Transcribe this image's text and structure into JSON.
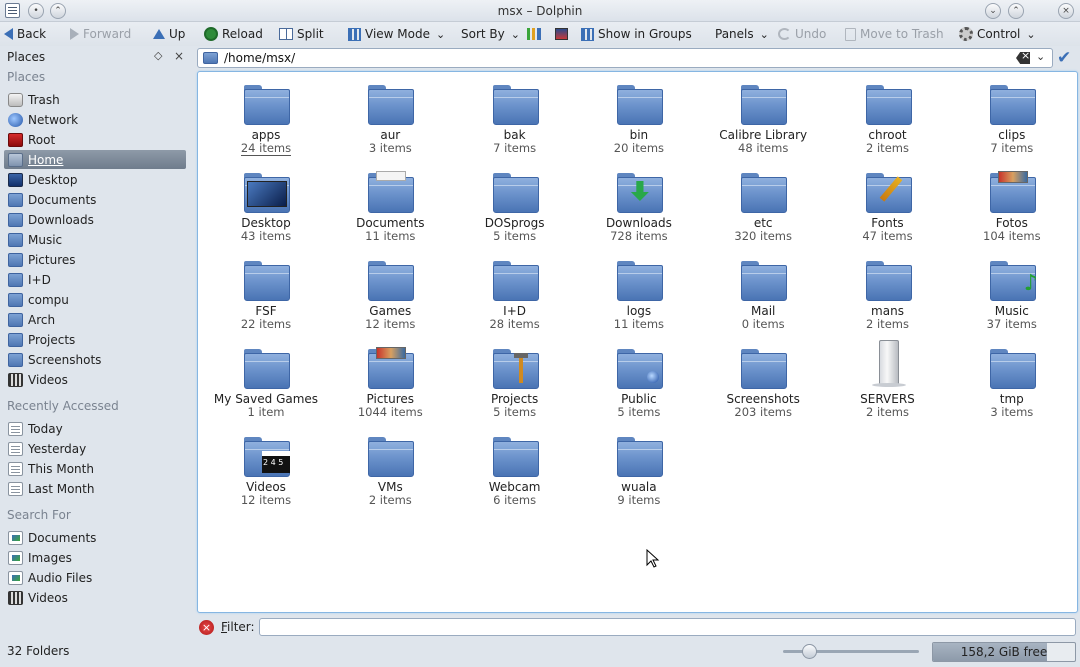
{
  "window": {
    "title": "msx – Dolphin"
  },
  "toolbar": {
    "back": "Back",
    "forward": "Forward",
    "up": "Up",
    "reload": "Reload",
    "split": "Split",
    "view_mode": "View Mode",
    "sort_by": "Sort By",
    "show_in_groups": "Show in Groups",
    "panels": "Panels",
    "undo": "Undo",
    "move_to_trash": "Move to Trash",
    "control": "Control"
  },
  "sidebar": {
    "panel_title": "Places",
    "places_title": "Places",
    "places": [
      {
        "label": "Trash",
        "icon": "trash-icon"
      },
      {
        "label": "Network",
        "icon": "network-icon"
      },
      {
        "label": "Root",
        "icon": "root-icon"
      },
      {
        "label": "Home",
        "icon": "home-icon"
      },
      {
        "label": "Desktop",
        "icon": "desktop-icon"
      },
      {
        "label": "Documents",
        "icon": "folder-icon"
      },
      {
        "label": "Downloads",
        "icon": "folder-icon"
      },
      {
        "label": "Music",
        "icon": "folder-icon"
      },
      {
        "label": "Pictures",
        "icon": "folder-icon"
      },
      {
        "label": "I+D",
        "icon": "folder-icon"
      },
      {
        "label": "compu",
        "icon": "folder-icon"
      },
      {
        "label": "Arch",
        "icon": "folder-icon"
      },
      {
        "label": "Projects",
        "icon": "folder-icon"
      },
      {
        "label": "Screenshots",
        "icon": "folder-icon"
      },
      {
        "label": "Videos",
        "icon": "video-icon"
      }
    ],
    "recent_title": "Recently Accessed",
    "recent": [
      {
        "label": "Today"
      },
      {
        "label": "Yesterday"
      },
      {
        "label": "This Month"
      },
      {
        "label": "Last Month"
      }
    ],
    "search_title": "Search For",
    "search": [
      {
        "label": "Documents"
      },
      {
        "label": "Images"
      },
      {
        "label": "Audio Files"
      },
      {
        "label": "Videos"
      }
    ]
  },
  "location": {
    "path": "/home/msx/"
  },
  "folders": [
    {
      "name": "apps",
      "count": "24 items"
    },
    {
      "name": "aur",
      "count": "3 items"
    },
    {
      "name": "bak",
      "count": "7 items"
    },
    {
      "name": "bin",
      "count": "20 items"
    },
    {
      "name": "Calibre Library",
      "count": "48 items"
    },
    {
      "name": "chroot",
      "count": "2 items"
    },
    {
      "name": "clips",
      "count": "7 items"
    },
    {
      "name": "Desktop",
      "count": "43 items"
    },
    {
      "name": "Documents",
      "count": "11 items"
    },
    {
      "name": "DOSprogs",
      "count": "5 items"
    },
    {
      "name": "Downloads",
      "count": "728 items"
    },
    {
      "name": "etc",
      "count": "320 items"
    },
    {
      "name": "Fonts",
      "count": "47 items"
    },
    {
      "name": "Fotos",
      "count": "104 items"
    },
    {
      "name": "FSF",
      "count": "22 items"
    },
    {
      "name": "Games",
      "count": "12 items"
    },
    {
      "name": "I+D",
      "count": "28 items"
    },
    {
      "name": "logs",
      "count": "11 items"
    },
    {
      "name": "Mail",
      "count": "0 items"
    },
    {
      "name": "mans",
      "count": "2 items"
    },
    {
      "name": "Music",
      "count": "37 items"
    },
    {
      "name": "My Saved Games",
      "count": "1 item"
    },
    {
      "name": "Pictures",
      "count": "1044 items"
    },
    {
      "name": "Projects",
      "count": "5 items"
    },
    {
      "name": "Public",
      "count": "5 items"
    },
    {
      "name": "Screenshots",
      "count": "203 items"
    },
    {
      "name": "SERVERS",
      "count": "2 items"
    },
    {
      "name": "tmp",
      "count": "3 items"
    },
    {
      "name": "Videos",
      "count": "12 items"
    },
    {
      "name": "VMs",
      "count": "2 items"
    },
    {
      "name": "Webcam",
      "count": "6 items"
    },
    {
      "name": "wuala",
      "count": "9 items"
    }
  ],
  "filter": {
    "label_accel": "F",
    "label_rest": "ilter:",
    "value": ""
  },
  "status": {
    "text": "32 Folders",
    "free_space": "158,2 GiB free",
    "used_fraction": 0.8,
    "zoom_fraction": 0.2
  },
  "colors": {
    "accent": "#3b6fb6",
    "folder": "#6c93cc",
    "selection": "#7f8c9c",
    "view_border": "#86b6e2"
  }
}
